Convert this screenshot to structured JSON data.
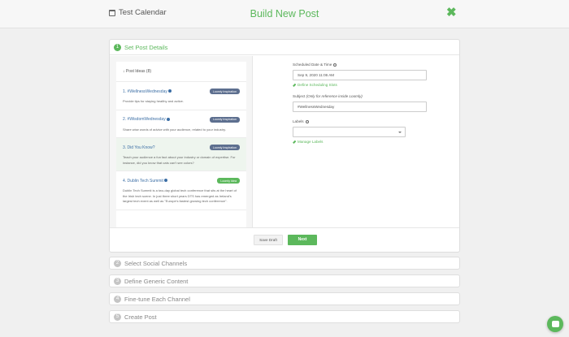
{
  "header": {
    "calendar_name": "Test Calendar",
    "page_title": "Build New Post",
    "close_symbol": "✖"
  },
  "colors": {
    "accent": "#5cb85c",
    "badge_blue": "#5d6f8f",
    "link_blue": "#3b6ea5"
  },
  "steps": [
    {
      "num": "1",
      "label": "Set Post Details"
    },
    {
      "num": "2",
      "label": "Select Social Channels"
    },
    {
      "num": "3",
      "label": "Define Generic Content"
    },
    {
      "num": "4",
      "label": "Fine-tune Each Channel"
    },
    {
      "num": "5",
      "label": "Create Post"
    }
  ],
  "ideas": {
    "header": "↓ Post Ideas (8)",
    "items": [
      {
        "title": "1. #WellnessWednesday",
        "badge": "Loomly Inspiration",
        "desc": "Provide tips for staying healthy and active."
      },
      {
        "title": "2. #WisdomWednesday",
        "badge": "Loomly Inspiration",
        "desc": "Share wise words of advice with your audience, related to your industry."
      },
      {
        "title": "3. Did You Know?",
        "badge": "Loomly Inspiration",
        "desc": "Teach your audience a fun fact about your industry or domain of expertise. For instance, did you know that cats can't see colors?"
      },
      {
        "title": "4. Dublin Tech Summit",
        "badge": "Loomly Idea",
        "desc": "Dublin Tech Summit is a two-day global tech conference that sits at the heart of the Irish tech scene. In just three short years DTS has emerged as Ireland's largest tech event as well as \"Europe's fastest growing tech conference\"."
      }
    ]
  },
  "form": {
    "date_label": "Scheduled Date & Time",
    "date_value": "Sep 9, 2020 11:06 AM",
    "scheduling_link": "Define Scheduling Slots",
    "subject_label": "Subject",
    "subject_hint": "(Only for reference inside Loomly)",
    "subject_value": "#WellnessWednesday",
    "labels_label": "Labels",
    "labels_link": "Manage Labels"
  },
  "buttons": {
    "save_draft": "Save Draft",
    "next": "Next"
  }
}
